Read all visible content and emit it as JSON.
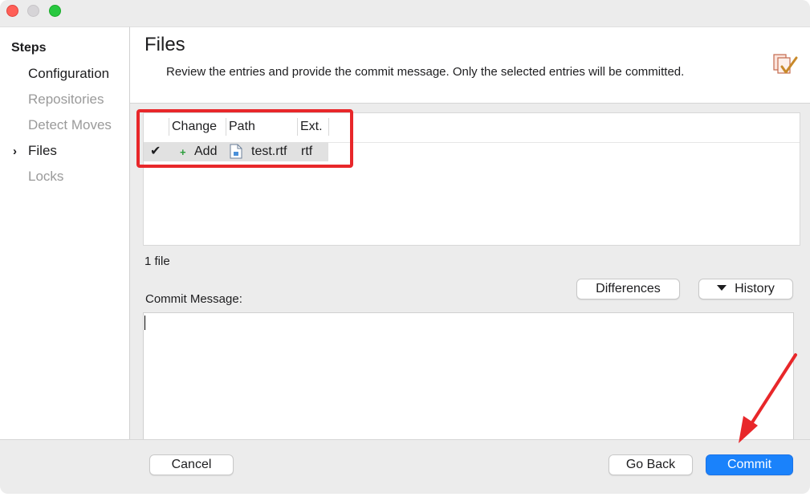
{
  "sidebar": {
    "title": "Steps",
    "items": [
      {
        "label": "Configuration",
        "state": "enabled"
      },
      {
        "label": "Repositories",
        "state": "disabled"
      },
      {
        "label": "Detect Moves",
        "state": "disabled"
      },
      {
        "label": "Files",
        "state": "current"
      },
      {
        "label": "Locks",
        "state": "disabled"
      }
    ],
    "current_marker": "›"
  },
  "header": {
    "title": "Files",
    "description": "Review the entries and provide the commit message. Only the selected entries will be committed."
  },
  "table": {
    "columns": [
      "Change",
      "Path",
      "Ext."
    ],
    "rows": [
      {
        "checked": true,
        "check_glyph": "✔",
        "change_glyph": "+",
        "change": "Add",
        "path": "test.rtf",
        "ext": "rtf"
      }
    ]
  },
  "file_count": "1 file",
  "commit_message": {
    "label": "Commit Message:",
    "value": ""
  },
  "buttons": {
    "differences": "Differences",
    "history": "History",
    "cancel": "Cancel",
    "go_back": "Go Back",
    "commit": "Commit"
  },
  "colors": {
    "accent": "#1a82fb",
    "annotation": "#e8272a",
    "add": "#2a9d3b"
  }
}
